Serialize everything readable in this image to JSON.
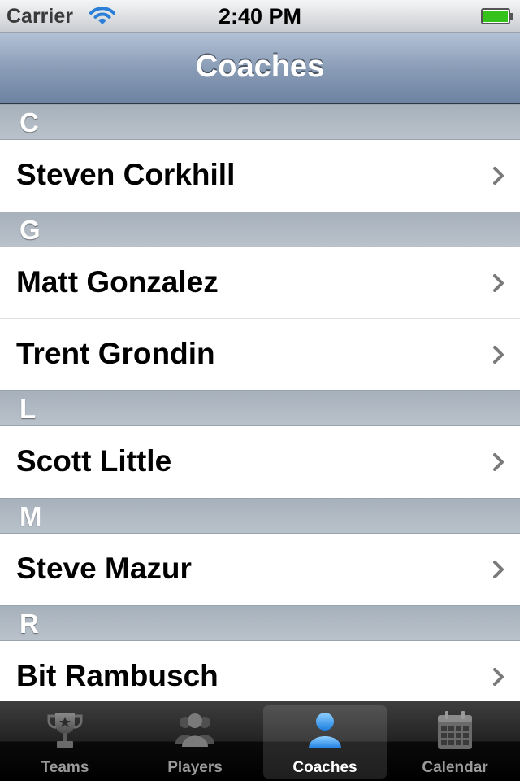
{
  "status_bar": {
    "carrier": "Carrier",
    "time": "2:40 PM"
  },
  "nav": {
    "title": "Coaches"
  },
  "sections": [
    {
      "letter": "C",
      "rows": [
        {
          "name": "Steven Corkhill"
        }
      ]
    },
    {
      "letter": "G",
      "rows": [
        {
          "name": "Matt Gonzalez"
        },
        {
          "name": "Trent Grondin"
        }
      ]
    },
    {
      "letter": "L",
      "rows": [
        {
          "name": "Scott Little"
        }
      ]
    },
    {
      "letter": "M",
      "rows": [
        {
          "name": "Steve Mazur"
        }
      ]
    },
    {
      "letter": "R",
      "rows": [
        {
          "name": "Bit Rambusch"
        }
      ]
    }
  ],
  "tabs": [
    {
      "label": "Teams",
      "icon": "trophy-icon"
    },
    {
      "label": "Players",
      "icon": "people-icon"
    },
    {
      "label": "Coaches",
      "icon": "person-icon",
      "selected": true
    },
    {
      "label": "Calendar",
      "icon": "calendar-icon"
    }
  ],
  "colors": {
    "selected_tab": "#2f9cf0",
    "nav_bar": "#8a9db7",
    "battery": "#35c21b"
  }
}
